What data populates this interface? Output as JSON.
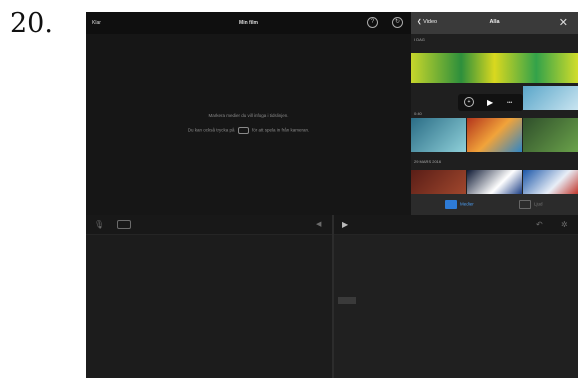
{
  "step_number": "20.",
  "topbar": {
    "done_label": "Klar",
    "title": "Min film",
    "help_icon": "help-icon",
    "settings_icon": "settings-icon"
  },
  "viewer": {
    "hint_line1": "Markera medier du vill infoga i tidslinjen.",
    "hint_line2_pre": "Du kan också trycka på",
    "hint_line2_post": "för att spela in från kameran."
  },
  "browser": {
    "back_label": "Video",
    "title": "Alla",
    "close_icon": "close-icon",
    "section1": "I DAG",
    "duration": "0:40",
    "section2": "29 MARS 2016",
    "tabs": [
      {
        "label": "Medier",
        "color": "#2e7bd6",
        "active": true
      },
      {
        "label": "Ljud",
        "color": "#555555",
        "active": false
      }
    ]
  },
  "timeline": {
    "mic_icon": "mic-icon",
    "camera_icon": "camera-icon",
    "volume_icon": "speaker-icon",
    "play_icon": "play-icon",
    "undo_icon": "undo-icon",
    "gear_icon": "gear-icon"
  }
}
